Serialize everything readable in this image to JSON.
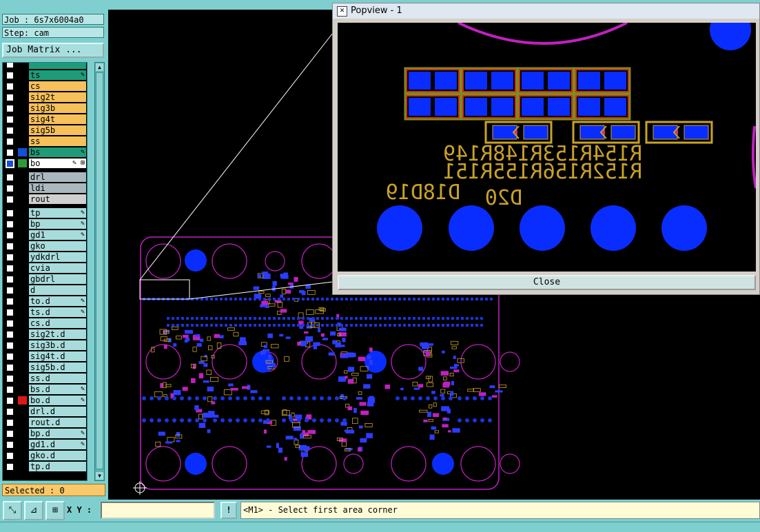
{
  "job": {
    "job_text": "Job : 6s7x6004a0",
    "step_text": "Step: cam"
  },
  "buttons": {
    "job_matrix": "Job Matrix ..."
  },
  "layers": [
    {
      "name": "",
      "color": "#1e9c7a",
      "flag": "",
      "check": true
    },
    {
      "name": "ts",
      "color": "#1e9c7a",
      "flag": "✎",
      "check": true
    },
    {
      "name": "cs",
      "color": "#f6c05a",
      "flag": "",
      "check": true
    },
    {
      "name": "sig2t",
      "color": "#f6c05a",
      "flag": "",
      "check": true
    },
    {
      "name": "sig3b",
      "color": "#f6c05a",
      "flag": "",
      "check": true
    },
    {
      "name": "sig4t",
      "color": "#f6c05a",
      "flag": "",
      "check": true
    },
    {
      "name": "sig5b",
      "color": "#f6c05a",
      "flag": "",
      "check": true
    },
    {
      "name": "ss",
      "color": "#f6c05a",
      "flag": "",
      "check": true
    },
    {
      "name": "bs",
      "color": "#1e9c7a",
      "flag": "✎",
      "check": true,
      "swatch": "#1450d8"
    },
    {
      "name": "bo",
      "color": "#ffffff",
      "flag": "✎ ⊞",
      "check": true,
      "swatch": "#2e9a3a",
      "active": true
    },
    {
      "name": "drl",
      "color": "#a9b8be",
      "flag": "",
      "check": true
    },
    {
      "name": "ldi",
      "color": "#a9b8be",
      "flag": "",
      "check": true
    },
    {
      "name": "rout",
      "color": "#d0d0d0",
      "flag": "",
      "check": true
    },
    {
      "name": "tp",
      "color": "#a8dcdc",
      "flag": "✎",
      "check": true
    },
    {
      "name": "bp",
      "color": "#a8dcdc",
      "flag": "✎",
      "check": true
    },
    {
      "name": "gd1",
      "color": "#a8dcdc",
      "flag": "✎",
      "check": true
    },
    {
      "name": "gko",
      "color": "#a8dcdc",
      "flag": "",
      "check": true
    },
    {
      "name": "ydkdrl",
      "color": "#a8dcdc",
      "flag": "",
      "check": true
    },
    {
      "name": "cvia",
      "color": "#a8dcdc",
      "flag": "",
      "check": true
    },
    {
      "name": "gbdrl",
      "color": "#a8dcdc",
      "flag": "",
      "check": true
    },
    {
      "name": "d",
      "color": "#a8dcdc",
      "flag": "",
      "check": true
    },
    {
      "name": "to.d",
      "color": "#a8dcdc",
      "flag": "✎",
      "check": true
    },
    {
      "name": "ts.d",
      "color": "#a8dcdc",
      "flag": "✎",
      "check": true
    },
    {
      "name": "cs.d",
      "color": "#a8dcdc",
      "flag": "",
      "check": true
    },
    {
      "name": "sig2t.d",
      "color": "#a8dcdc",
      "flag": "",
      "check": true
    },
    {
      "name": "sig3b.d",
      "color": "#a8dcdc",
      "flag": "",
      "check": true
    },
    {
      "name": "sig4t.d",
      "color": "#a8dcdc",
      "flag": "",
      "check": true
    },
    {
      "name": "sig5b.d",
      "color": "#a8dcdc",
      "flag": "",
      "check": true
    },
    {
      "name": "ss.d",
      "color": "#a8dcdc",
      "flag": "",
      "check": true
    },
    {
      "name": "bs.d",
      "color": "#a8dcdc",
      "flag": "✎",
      "check": true
    },
    {
      "name": "bo.d",
      "color": "#a8dcdc",
      "flag": "✎",
      "check": true,
      "swatch": "#e01818"
    },
    {
      "name": "drl.d",
      "color": "#a8dcdc",
      "flag": "",
      "check": true
    },
    {
      "name": "rout.d",
      "color": "#a8dcdc",
      "flag": "",
      "check": true
    },
    {
      "name": "bp.d",
      "color": "#a8dcdc",
      "flag": "✎",
      "check": true
    },
    {
      "name": "gd1.d",
      "color": "#a8dcdc",
      "flag": "✎",
      "check": true
    },
    {
      "name": "gko.d",
      "color": "#a8dcdc",
      "flag": "",
      "check": true
    },
    {
      "name": "tp.d",
      "color": "#a8dcdc",
      "flag": "",
      "check": true
    }
  ],
  "status": {
    "selected": "Selected : 0"
  },
  "bottom": {
    "xy_label": "X Y :",
    "xy_value": "",
    "prompt": "<M1> - Select first area corner",
    "alert": "!"
  },
  "popview": {
    "title": "Popview - 1",
    "close_label": "Close",
    "silk_line1": "R154R153R148R149",
    "silk_line2": "R152R156R155R151",
    "silk_line3": "D18D19",
    "silk_line4": "D20"
  },
  "colors": {
    "panel": "#7fcfcf",
    "pad_blue": "#0a2dff",
    "silk": "#c9a227",
    "outline": "#c020c0"
  },
  "icons": [
    "zoom-fit-icon",
    "zoom-area-icon",
    "pan-icon",
    "crosshair-icon",
    "window-icon"
  ]
}
